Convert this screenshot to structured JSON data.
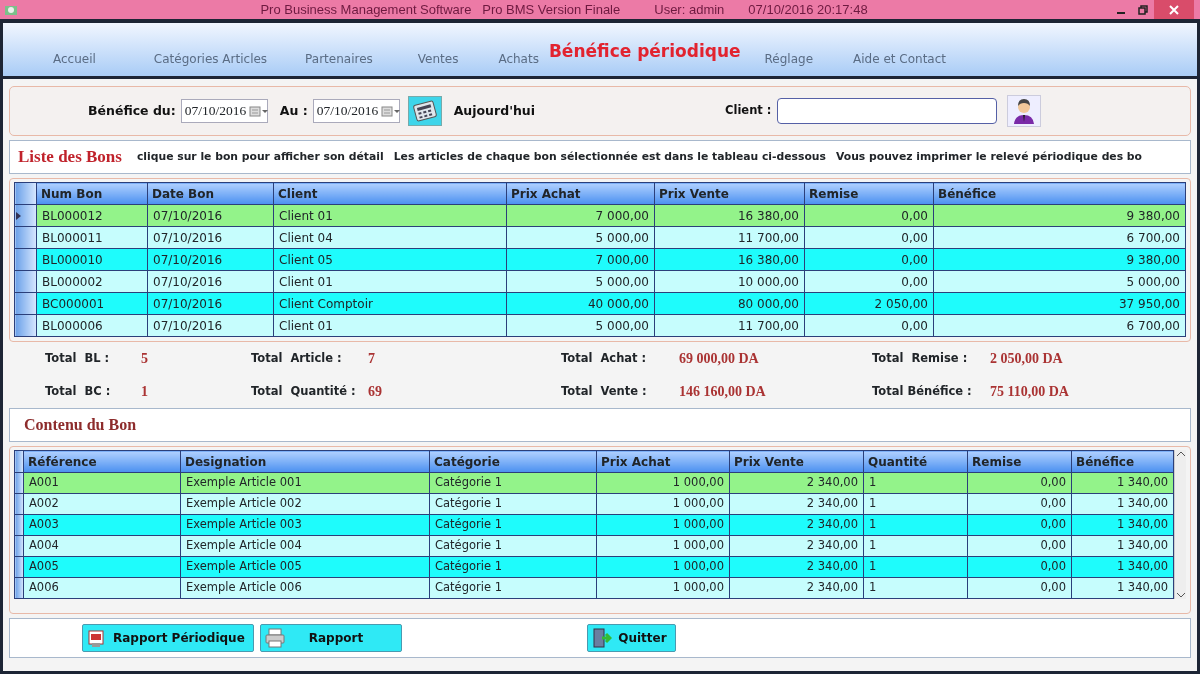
{
  "title_bar": {
    "app": "Pro Business Management Software   Pro BMS Version Finale",
    "user": "User: admin",
    "datetime": "07/10/2016 20:17:48"
  },
  "background_tabs": [
    "Accueil",
    "Catégories Articles",
    "Partenaires",
    "Ventes",
    "Achats",
    "Réglage",
    "Aide et Contact"
  ],
  "dialog_title": "Bénéfice périodique",
  "filter": {
    "from_label": "Bénéfice du:",
    "from_value": "07/10/2016",
    "to_label": "Au :",
    "to_value": "07/10/2016",
    "today_label": "Aujourd'hui",
    "client_label": "Client :"
  },
  "info_bar": {
    "title": "Liste des Bons",
    "messages": [
      "clique sur le bon pour afficher son détail",
      "Les articles de chaque bon sélectionnée est dans le tableau ci-dessous",
      "Vous pouvez imprimer le relevé périodique des bo"
    ]
  },
  "bons_table": {
    "columns": [
      {
        "label": "Num Bon",
        "numeric": false
      },
      {
        "label": "Date Bon",
        "numeric": false
      },
      {
        "label": "Client",
        "numeric": false
      },
      {
        "label": "Prix Achat",
        "numeric": true
      },
      {
        "label": "Prix Vente",
        "numeric": true
      },
      {
        "label": "Remise",
        "numeric": true
      },
      {
        "label": "Bénéfice",
        "numeric": true
      }
    ],
    "rows": [
      {
        "selected": true,
        "cells": [
          "BL000012",
          "07/10/2016",
          "Client 01",
          "7 000,00",
          "16 380,00",
          "0,00",
          "9 380,00"
        ]
      },
      {
        "selected": false,
        "cells": [
          "BL000011",
          "07/10/2016",
          "Client 04",
          "5 000,00",
          "11 700,00",
          "0,00",
          "6 700,00"
        ]
      },
      {
        "selected": false,
        "cells": [
          "BL000010",
          "07/10/2016",
          "Client 05",
          "7 000,00",
          "16 380,00",
          "0,00",
          "9 380,00"
        ]
      },
      {
        "selected": false,
        "cells": [
          "BL000002",
          "07/10/2016",
          "Client 01",
          "5 000,00",
          "10 000,00",
          "0,00",
          "5 000,00"
        ]
      },
      {
        "selected": false,
        "cells": [
          "BC000001",
          "07/10/2016",
          "Client Comptoir",
          "40 000,00",
          "80 000,00",
          "2 050,00",
          "37 950,00"
        ]
      },
      {
        "selected": false,
        "cells": [
          "BL000006",
          "07/10/2016",
          "Client 01",
          "5 000,00",
          "11 700,00",
          "0,00",
          "6 700,00"
        ]
      }
    ]
  },
  "totals": [
    {
      "label": "Total  BL :",
      "value": "5"
    },
    {
      "label": "Total  Article :",
      "value": "7"
    },
    {
      "label": "Total  Achat :",
      "value": "69 000,00 DA"
    },
    {
      "label": "Total  Remise :",
      "value": "2 050,00 DA"
    },
    {
      "label": "Total  BC :",
      "value": "1"
    },
    {
      "label": "Total  Quantité :",
      "value": "69"
    },
    {
      "label": "Total  Vente :",
      "value": "146 160,00 DA"
    },
    {
      "label": "Total Bénéfice :",
      "value": "75 110,00 DA"
    }
  ],
  "content_title": "Contenu du Bon",
  "articles_table": {
    "columns": [
      {
        "label": "Référence",
        "numeric": false
      },
      {
        "label": "Designation",
        "numeric": false
      },
      {
        "label": "Catégorie",
        "numeric": false
      },
      {
        "label": "Prix Achat",
        "numeric": true
      },
      {
        "label": "Prix Vente",
        "numeric": true
      },
      {
        "label": "Quantité",
        "numeric": false
      },
      {
        "label": "Remise",
        "numeric": true
      },
      {
        "label": "Bénéfice",
        "numeric": true
      }
    ],
    "rows": [
      {
        "selected": true,
        "cells": [
          "A001",
          "Exemple Article 001",
          "Catégorie 1",
          "1 000,00",
          "2 340,00",
          "1",
          "0,00",
          "1 340,00"
        ]
      },
      {
        "selected": false,
        "cells": [
          "A002",
          "Exemple Article 002",
          "Catégorie 1",
          "1 000,00",
          "2 340,00",
          "1",
          "0,00",
          "1 340,00"
        ]
      },
      {
        "selected": false,
        "cells": [
          "A003",
          "Exemple Article 003",
          "Catégorie 1",
          "1 000,00",
          "2 340,00",
          "1",
          "0,00",
          "1 340,00"
        ]
      },
      {
        "selected": false,
        "cells": [
          "A004",
          "Exemple Article 004",
          "Catégorie 1",
          "1 000,00",
          "2 340,00",
          "1",
          "0,00",
          "1 340,00"
        ]
      },
      {
        "selected": false,
        "cells": [
          "A005",
          "Exemple Article 005",
          "Catégorie 1",
          "1 000,00",
          "2 340,00",
          "1",
          "0,00",
          "1 340,00"
        ]
      },
      {
        "selected": false,
        "cells": [
          "A006",
          "Exemple Article 006",
          "Catégorie 1",
          "1 000,00",
          "2 340,00",
          "1",
          "0,00",
          "1 340,00"
        ]
      }
    ]
  },
  "buttons": [
    {
      "kind": "report",
      "label": "Rapport Périodique"
    },
    {
      "kind": "print",
      "label": "Rapport"
    },
    {
      "kind": "quit",
      "label": "Quitter"
    }
  ]
}
